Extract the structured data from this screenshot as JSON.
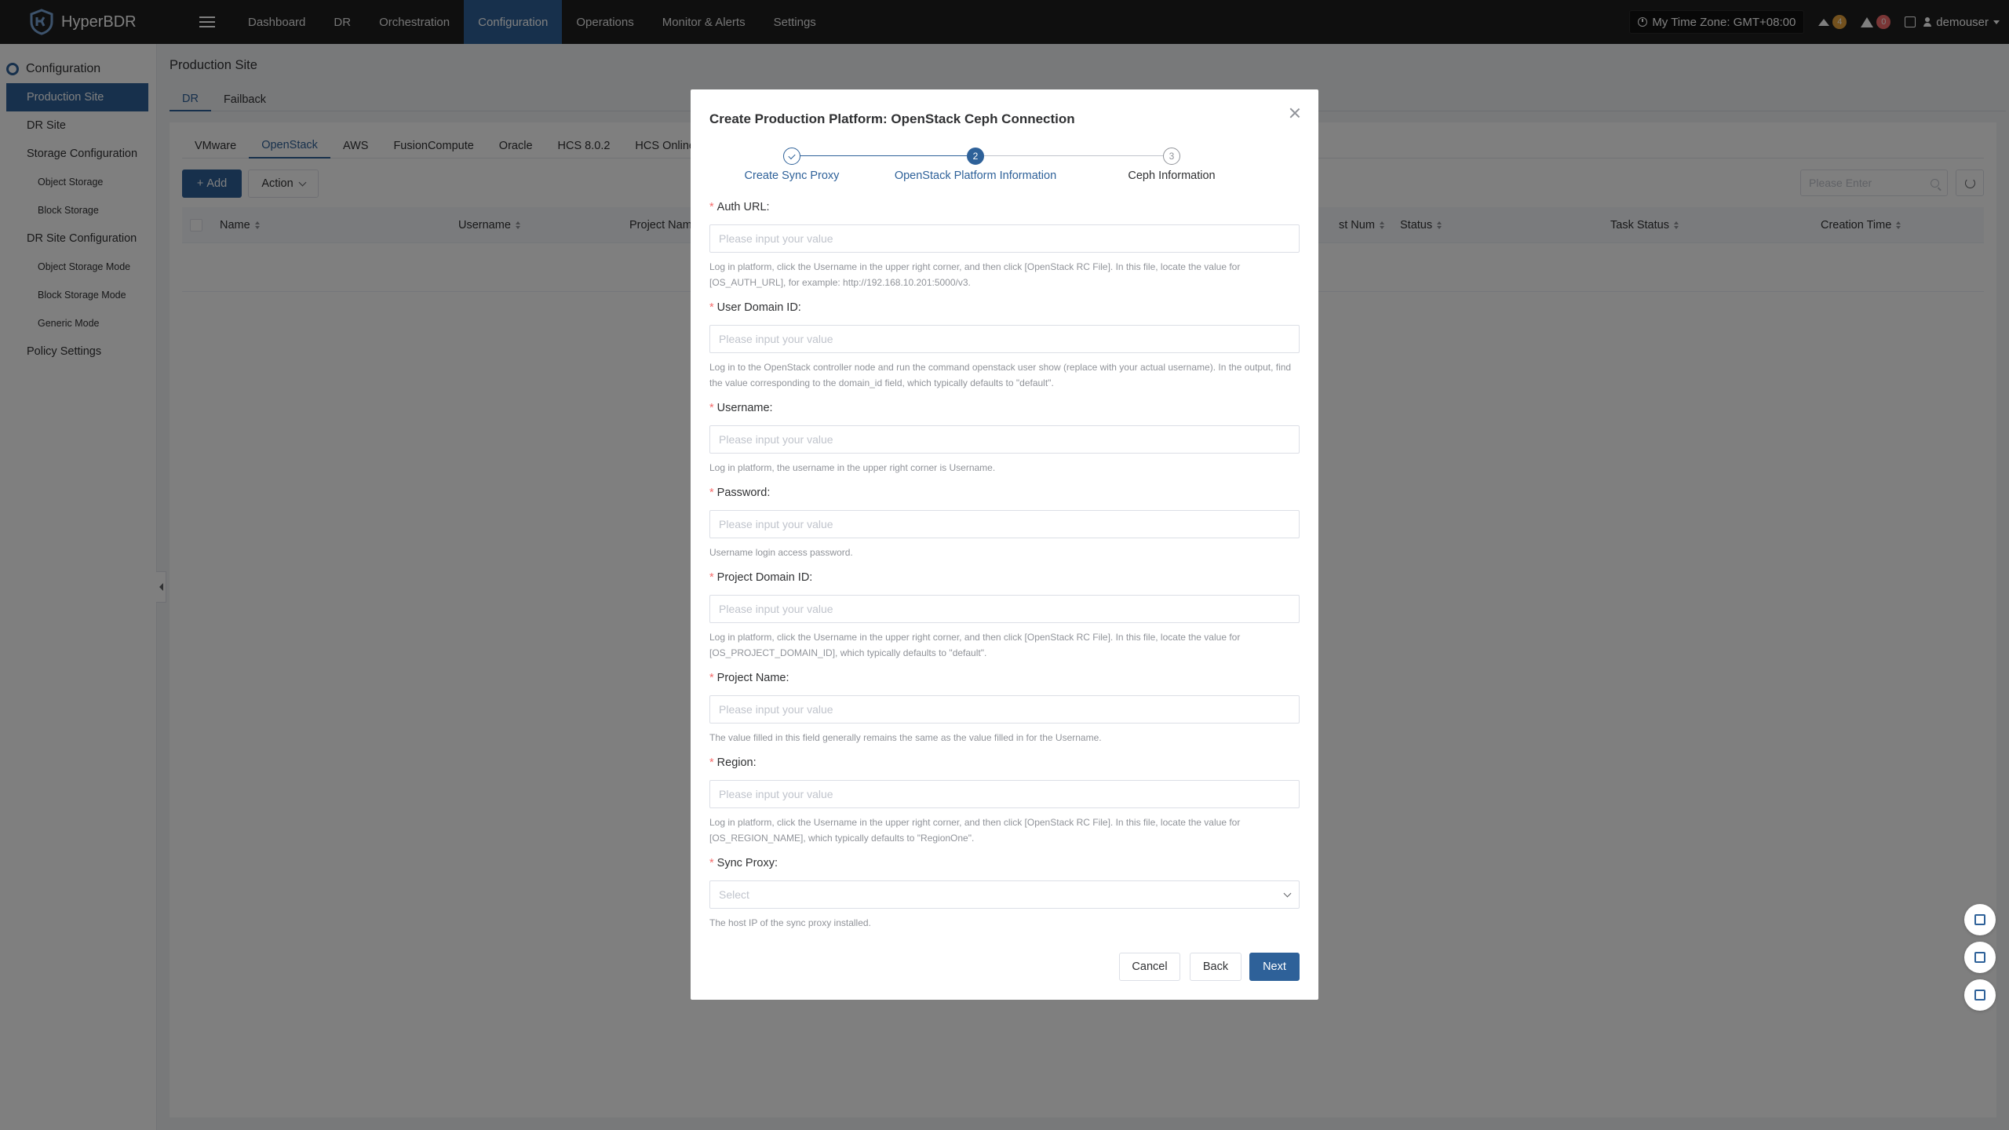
{
  "app": {
    "name": "HyperBDR"
  },
  "nav": {
    "items": [
      "Dashboard",
      "DR",
      "Orchestration",
      "Configuration",
      "Operations",
      "Monitor & Alerts",
      "Settings"
    ],
    "active": "Configuration",
    "timezone": "My Time Zone: GMT+08:00",
    "upgrade_count": "4",
    "alert_count": "0",
    "user": "demouser"
  },
  "sidebar": {
    "title": "Configuration",
    "items": [
      {
        "label": "Production Site"
      },
      {
        "label": "DR Site"
      },
      {
        "label": "Storage Configuration"
      },
      {
        "label": "Object Storage"
      },
      {
        "label": "Block Storage"
      },
      {
        "label": "DR Site Configuration"
      },
      {
        "label": "Object Storage Mode"
      },
      {
        "label": "Block Storage Mode"
      },
      {
        "label": "Generic Mode"
      },
      {
        "label": "Policy Settings"
      }
    ]
  },
  "page": {
    "title": "Production Site",
    "tabs": [
      "DR",
      "Failback"
    ],
    "platform_tabs": [
      "VMware",
      "OpenStack",
      "AWS",
      "FusionCompute",
      "Oracle",
      "HCS 8.0.2",
      "HCS Online"
    ],
    "add_label": "Add",
    "action_label": "Action",
    "search_placeholder": "Please Enter",
    "columns": [
      "Name",
      "Username",
      "Project Nam",
      "st Num",
      "Status",
      "Task Status",
      "Creation Time"
    ]
  },
  "modal": {
    "title": "Create Production Platform: OpenStack Ceph Connection",
    "steps": [
      {
        "label": "Create Sync Proxy",
        "state": "done"
      },
      {
        "label": "OpenStack Platform Information",
        "number": "2",
        "state": "active"
      },
      {
        "label": "Ceph Information",
        "number": "3",
        "state": "wait"
      }
    ],
    "fields": [
      {
        "label": "Auth URL:",
        "placeholder": "Please input your value",
        "hint": "Log in platform, click the Username in the upper right corner, and then click [OpenStack RC File]. In this file, locate the value for [OS_AUTH_URL], for example: http://192.168.10.201:5000/v3."
      },
      {
        "label": "User Domain ID:",
        "placeholder": "Please input your value",
        "hint": "Log in to the OpenStack controller node and run the command openstack user show (replace with your actual username). In the output, find the value corresponding to the domain_id field, which typically defaults to \"default\"."
      },
      {
        "label": "Username:",
        "placeholder": "Please input your value",
        "hint": "Log in platform, the username in the upper right corner is Username."
      },
      {
        "label": "Password:",
        "placeholder": "Please input your value",
        "hint": "Username login access password."
      },
      {
        "label": "Project Domain ID:",
        "placeholder": "Please input your value",
        "hint": "Log in platform, click the Username in the upper right corner, and then click [OpenStack RC File]. In this file, locate the value for [OS_PROJECT_DOMAIN_ID], which typically defaults to \"default\"."
      },
      {
        "label": "Project Name:",
        "placeholder": "Please input your value",
        "hint": "The value filled in this field generally remains the same as the value filled in for the Username."
      },
      {
        "label": "Region:",
        "placeholder": "Please input your value",
        "hint": "Log in platform, click the Username in the upper right corner, and then click [OpenStack RC File]. In this file, locate the value for [OS_REGION_NAME], which typically defaults to \"RegionOne\"."
      },
      {
        "label": "Sync Proxy:",
        "placeholder": "Select",
        "hint": "The host IP of the sync proxy installed."
      }
    ],
    "buttons": {
      "cancel": "Cancel",
      "back": "Back",
      "next": "Next"
    }
  },
  "colors": {
    "primary": "#2e6199",
    "nav_bg": "#1f1f1f",
    "required": "#f56c6c"
  }
}
